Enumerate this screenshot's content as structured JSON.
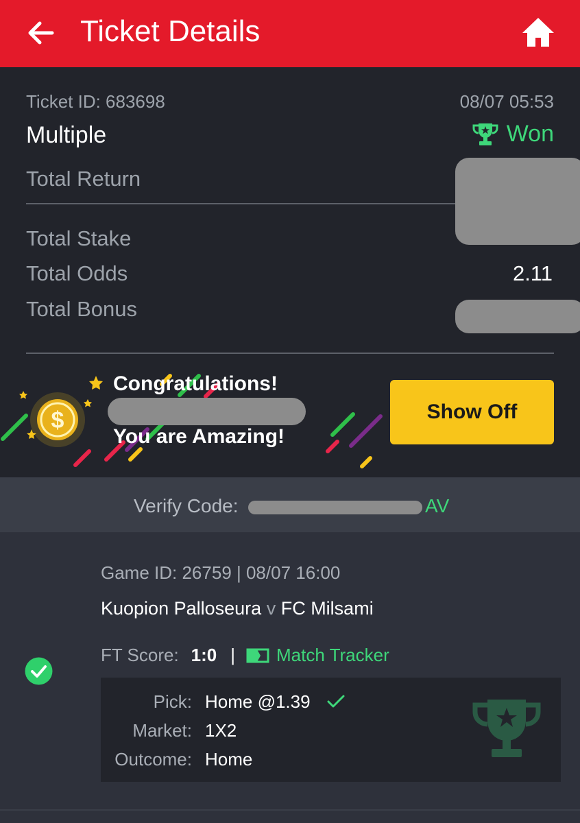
{
  "header": {
    "title": "Ticket Details",
    "back_icon": "arrow-left-icon",
    "home_icon": "home-icon"
  },
  "ticket": {
    "id_label": "Ticket ID: 683698",
    "datetime": "08/07 05:53",
    "type": "Multiple",
    "status": "Won",
    "status_icon": "trophy-icon",
    "total_return_label": "Total Return",
    "total_stake_label": "Total Stake",
    "total_odds_label": "Total Odds",
    "total_odds_value": "2.11",
    "total_bonus_label": "Total Bonus"
  },
  "banner": {
    "line1": "Congratulations!",
    "line2": "You are Amazing!",
    "button": "Show Off",
    "coin_icon": "dollar-coin-icon"
  },
  "verify": {
    "label": "Verify Code:",
    "code_visible": "AV"
  },
  "game": {
    "id_line": "Game ID: 26759 | 08/07 16:00",
    "home_team": "Kuopion Palloseura",
    "vs": "v",
    "away_team": "FC Milsami",
    "ft_label": "FT Score:",
    "ft_score": "1:0",
    "separator": "|",
    "tracker_label": "Match Tracker",
    "pick_label": "Pick:",
    "pick_value": "Home @1.39",
    "market_label": "Market:",
    "market_value": "1X2",
    "outcome_label": "Outcome:",
    "outcome_value": "Home"
  },
  "colors": {
    "header": "#e41a2a",
    "accent_green": "#3ed77a",
    "button_yellow": "#f8c51a",
    "panel_dark": "#22242b",
    "bg": "#2e313b"
  }
}
